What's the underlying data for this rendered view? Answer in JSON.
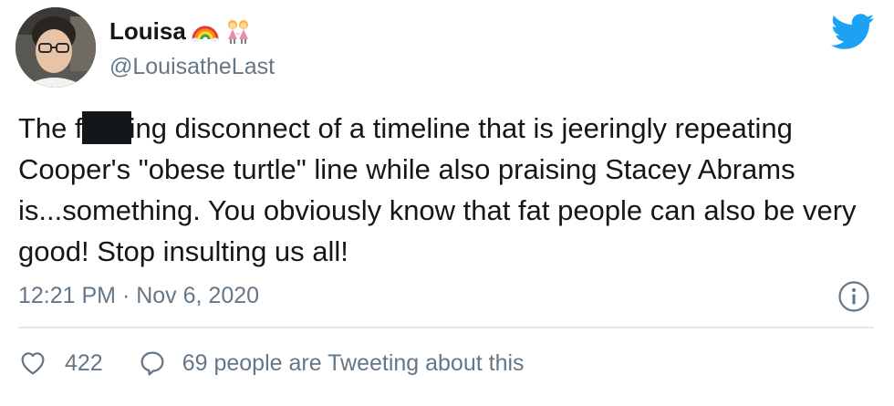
{
  "author": {
    "display_name": "Louisa",
    "handle": "@LouisatheLast",
    "name_emojis": [
      "rainbow-emoji",
      "women-holding-hands-emoji"
    ],
    "avatar": "profile-photo"
  },
  "brand": {
    "logo": "twitter-bird-icon",
    "color": "#1da1f2"
  },
  "tweet": {
    "text_part1": "The f",
    "redacted": true,
    "text_part2": "ing disconnect of a timeline that is jeeringly repeating Cooper's \"obese turtle\" line while also praising Stacey Abrams is...something. You obviously know that fat people can also be very good! Stop insulting us all!",
    "timestamp": "12:21 PM · Nov 6, 2020"
  },
  "engagement": {
    "like_icon": "heart-icon",
    "like_count": "422",
    "reply_icon": "speech-bubble-icon",
    "reply_label": "69 people are Tweeting about this",
    "info_icon": "info-icon"
  },
  "colors": {
    "text_primary": "#14171a",
    "text_secondary": "#657786",
    "divider": "#e1e8ed"
  }
}
